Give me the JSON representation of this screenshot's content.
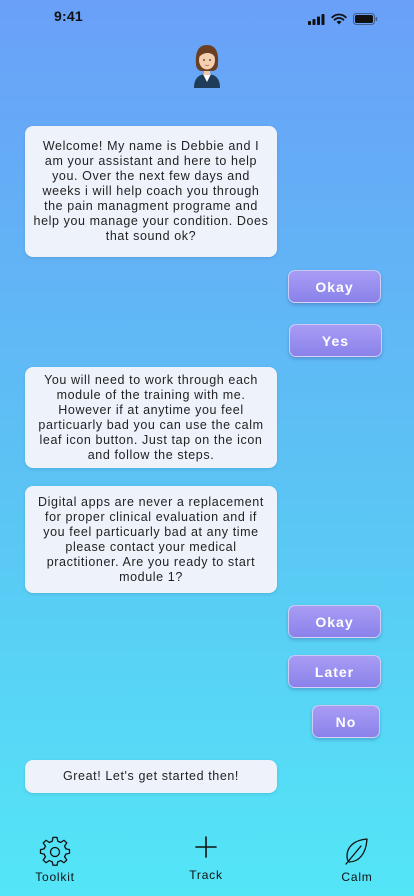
{
  "status_bar": {
    "time": "9:41"
  },
  "messages": [
    {
      "text": "Welcome! My name is Debbie and I am your assistant and here to help you. Over the next few days and weeks i will help coach you through the pain managment programe and help you manage your condition. Does that sound ok?"
    },
    {
      "text": "You will need to work through each module of the training with me. However if at anytime you feel particuarly bad you can use the calm leaf icon button. Just tap on the icon and follow the steps."
    },
    {
      "text": "Digital apps are never a replacement for proper clinical evaluation and if you feel particuarly bad at any time please contact your medical practitioner. Are you ready to start module 1?"
    },
    {
      "text": "Great! Let's get started then!"
    }
  ],
  "replies": [
    {
      "label": "Okay"
    },
    {
      "label": "Yes"
    },
    {
      "label": "Okay"
    },
    {
      "label": "Later"
    },
    {
      "label": "No"
    }
  ],
  "bottom_nav": {
    "items": [
      {
        "label": "Toolkit",
        "icon": "gear-icon"
      },
      {
        "label": "Track",
        "icon": "plus-icon"
      },
      {
        "label": "Calm",
        "icon": "leaf-icon"
      }
    ]
  },
  "colors": {
    "gradient_top": "#6aa0f8",
    "gradient_bottom": "#53e6f7",
    "bubble": "#eef3fb",
    "reply_button": "#8a82ea"
  }
}
